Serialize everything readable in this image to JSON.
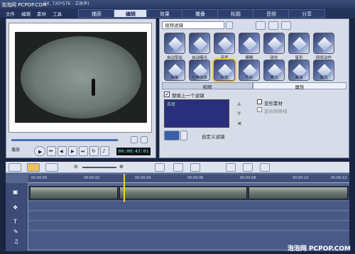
{
  "window": {
    "title": "FX, 720*576 - 立体声)"
  },
  "menu": [
    "文件",
    "编辑",
    "素材",
    "工具"
  ],
  "tabs": [
    "捕获",
    "编辑",
    "效果",
    "覆叠",
    "标题",
    "音频",
    "分享"
  ],
  "watermark_top": "泡泡网 PCPOP.COM",
  "watermark_bottom": "泡泡网  PCPOP.COM",
  "filters": {
    "dropdown": "视频滤镜",
    "items_row1": [
      "自动草绘",
      "自动曝光",
      "亮度",
      "模糊",
      "锐化",
      "星形",
      "网状动作"
    ],
    "items_row2": [
      "抽象",
      "拉伸球体",
      "去斑",
      "色彩",
      "黑白",
      "素描",
      "微风"
    ]
  },
  "props": {
    "tab_video": "视频",
    "tab_attr": "属性",
    "replace_label": "替换上一个滤镜",
    "list_item": "去斑",
    "distort": "变形素材",
    "show_grid": "显示网格线",
    "custom_filter": "自定义滤镜"
  },
  "player": {
    "play_label": "播放",
    "time": "00:00:43:01"
  },
  "ruler": [
    "00:00:00",
    "00:00:02",
    "00:00:04",
    "00:00:06",
    "00:00:08",
    "00:00:10",
    "00:00:12"
  ],
  "colors": {
    "accent": "#f1d039"
  }
}
